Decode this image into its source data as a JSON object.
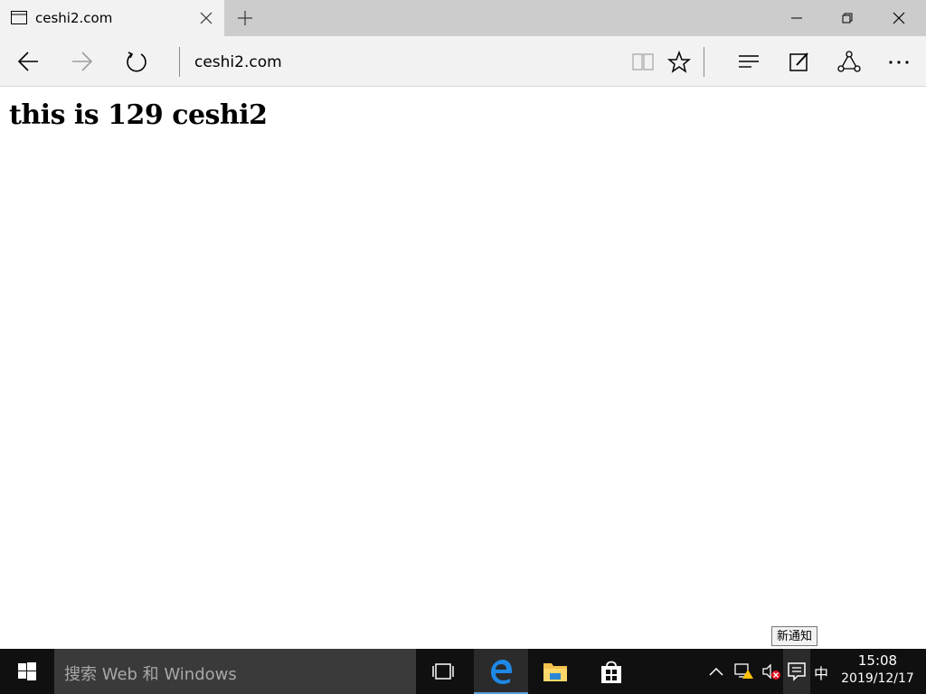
{
  "tab": {
    "title": "ceshi2.com"
  },
  "address_bar": {
    "url": "ceshi2.com"
  },
  "page": {
    "heading": "this is 129 ceshi2"
  },
  "tooltip": {
    "text": "新通知"
  },
  "taskbar": {
    "search_placeholder": "搜索 Web 和 Windows",
    "ime": "中",
    "time": "15:08",
    "date": "2019/12/17"
  },
  "colors": {
    "edge_blue": "#0078d7",
    "taskbar_bg": "#101010",
    "chrome_bg": "#f2f2f2"
  }
}
